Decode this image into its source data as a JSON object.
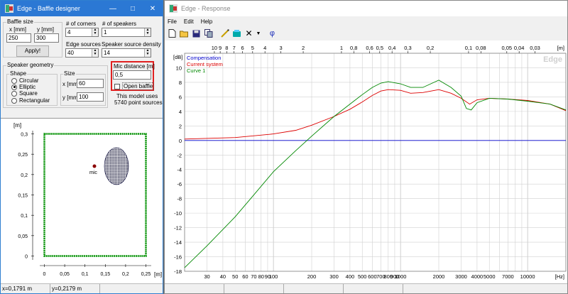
{
  "baffle": {
    "title": "Edge - Baffle designer",
    "baffle_size_label": "Baffle size",
    "x_label": "x [mm]",
    "y_label": "y [mm]",
    "x_value": "250",
    "y_value": "300",
    "apply_label": "Apply!",
    "corners_label": "# of corners",
    "corners_value": "4",
    "speakers_label": "# of speakers",
    "speakers_value": "1",
    "edge_sources_label": "Edge sources",
    "edge_sources_value": "40",
    "density_label": "Speaker source density",
    "density_value": "14",
    "geometry_label": "Speaker geometry",
    "shape_label": "Shape",
    "shapes": [
      "Circular",
      "Elliptic",
      "Square",
      "Rectangular"
    ],
    "size_label": "Size",
    "size_x_label": "x [mm]",
    "size_x_value": "60",
    "size_y_label": "y [mm]",
    "size_y_value": "100",
    "mic_label": "Mic distance [m]",
    "mic_value": "0,5",
    "open_baffle_label": "Open baffle",
    "model_line1": "This model uses",
    "model_line2": "5740 point sources",
    "plot_unit": "[m]",
    "plot_y_ticks": [
      "0,3",
      "0,25",
      "0,2",
      "0,15",
      "0,1",
      "0,05",
      "0"
    ],
    "plot_x_ticks": [
      "0",
      "0,05",
      "0,1",
      "0,15",
      "0,2",
      "0,25"
    ],
    "plot_x_unit": "[m]",
    "mic_marker": "mic",
    "status_x": "x=0,1791 m",
    "status_y": "y=0,2179 m"
  },
  "response": {
    "title": "Edge - Response",
    "menu": [
      "File",
      "Edit",
      "Help"
    ],
    "watermark": "Edge",
    "legend": [
      {
        "name": "Compensation",
        "color": "#0000cc"
      },
      {
        "name": "Current system",
        "color": "#dd0000"
      },
      {
        "name": "Curve 1",
        "color": "#008800"
      }
    ],
    "phi": "φ"
  },
  "colors": {
    "blue": "#0000cc",
    "red": "#dd0000",
    "green": "#008800",
    "grid": "#d0d0d0"
  },
  "chart_data": {
    "type": "line",
    "ylabel": "[dB]",
    "xlabel": "[Hz]",
    "x_scale": "log",
    "xlim": [
      20,
      20000
    ],
    "ylim": [
      -18,
      12
    ],
    "x_ticks": [
      "30",
      "40",
      "50",
      "60",
      "70",
      "80",
      "90",
      "100",
      "200",
      "300",
      "400",
      "500",
      "600",
      "700",
      "800",
      "900",
      "1000",
      "2000",
      "3000",
      "4000",
      "5000",
      "7000",
      "10000"
    ],
    "y_ticks": [
      "10",
      "8",
      "6",
      "4",
      "2",
      "0",
      "-2",
      "-4",
      "-6",
      "-8",
      "-10",
      "-12",
      "-14",
      "-16",
      "-18"
    ],
    "top_axis_label": "[m]",
    "top_ticks": [
      "10",
      "9",
      "8",
      "7",
      "6",
      "5",
      "4",
      "3",
      "2",
      "1",
      "0,8",
      "0,6",
      "0,5",
      "0,4",
      "0,3",
      "0,2",
      "0,1",
      "0,08",
      "0,05",
      "0,04",
      "0,03"
    ],
    "series": [
      {
        "name": "Compensation",
        "x": [
          20,
          20000
        ],
        "y": [
          0,
          0
        ]
      },
      {
        "name": "Current system",
        "x": [
          20,
          50,
          100,
          150,
          200,
          300,
          400,
          500,
          600,
          700,
          800,
          1000,
          1200,
          1500,
          2000,
          2500,
          3000,
          3500,
          4000,
          5000,
          7000,
          10000,
          15000,
          20000
        ],
        "y": [
          0.2,
          0.4,
          0.9,
          1.4,
          2.1,
          3.3,
          4.3,
          5.3,
          6.2,
          6.8,
          7.0,
          6.9,
          6.5,
          6.6,
          7.0,
          6.5,
          5.8,
          5.0,
          5.6,
          5.8,
          5.7,
          5.5,
          5.0,
          4.1
        ]
      },
      {
        "name": "Curve 1",
        "x": [
          20,
          30,
          50,
          70,
          100,
          150,
          200,
          300,
          400,
          500,
          600,
          700,
          800,
          1000,
          1200,
          1500,
          2000,
          2500,
          3000,
          3300,
          3600,
          4000,
          5000,
          7000,
          10000,
          15000,
          20000
        ],
        "y": [
          -17.5,
          -14.5,
          -10.5,
          -7.5,
          -4.3,
          -1.4,
          0.6,
          3.3,
          5.0,
          6.3,
          7.3,
          7.9,
          8.1,
          7.8,
          7.3,
          7.3,
          8.3,
          7.3,
          6.1,
          4.4,
          4.2,
          5.2,
          5.8,
          5.7,
          5.4,
          5.0,
          4.2
        ]
      }
    ]
  }
}
